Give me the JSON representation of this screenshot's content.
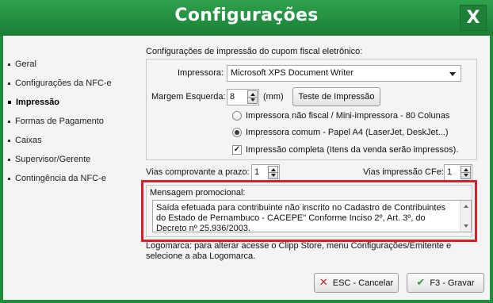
{
  "window": {
    "title": "Configurações",
    "close_label": "X"
  },
  "sidebar": {
    "items": [
      {
        "label": "Geral",
        "active": false
      },
      {
        "label": "Configurações da NFC-e",
        "active": false
      },
      {
        "label": "Impressão",
        "active": true
      },
      {
        "label": "Formas de Pagamento",
        "active": false
      },
      {
        "label": "Caixas",
        "active": false
      },
      {
        "label": "Supervisor/Gerente",
        "active": false
      },
      {
        "label": "Contingência da NFC-e",
        "active": false
      }
    ]
  },
  "print": {
    "header": "Configurações de impressão do cupom fiscal eletrônico:",
    "printer_label": "Impressora:",
    "printer_value": "Microsoft XPS Document Writer",
    "margin_label": "Margem Esquerda:",
    "margin_value": "8",
    "margin_unit": "(mm)",
    "test_button": "Teste de Impressão",
    "radio_options": [
      {
        "label": "Impressora não fiscal / Mini-impressora - 80 Colunas",
        "checked": false
      },
      {
        "label": "Impressora comum - Papel A4 (LaserJet, DeskJet...)",
        "checked": true
      }
    ],
    "full_print_label": "Impressão completa (Itens da venda serão impressos).",
    "full_print_checked": true
  },
  "copies": {
    "term_label": "Vias comprovante a prazo:",
    "term_value": "1",
    "cfe_label": "Vias impressão CFe:",
    "cfe_value": "1"
  },
  "message": {
    "label": "Mensagem promocional:",
    "text": "Saída efetuada para contribuinte não inscrito no Cadastro de Contribuintes do Estado de Pernambuco - CACEPE\" Conforme Inciso 2º, Art. 3º, do Decreto nº 25.936/2003."
  },
  "note": "Logomarca: para alterar acesse o Clipp Store, menu Configurações/Emitente e selecione a aba Logomarca.",
  "buttons": {
    "cancel": "ESC - Cancelar",
    "save": "F3 - Gravar"
  },
  "colors": {
    "title_bar": "#1f8d3c",
    "highlight_frame": "#d4222a",
    "cancel_icon": "#c4252b",
    "save_icon": "#2f9a3f"
  }
}
